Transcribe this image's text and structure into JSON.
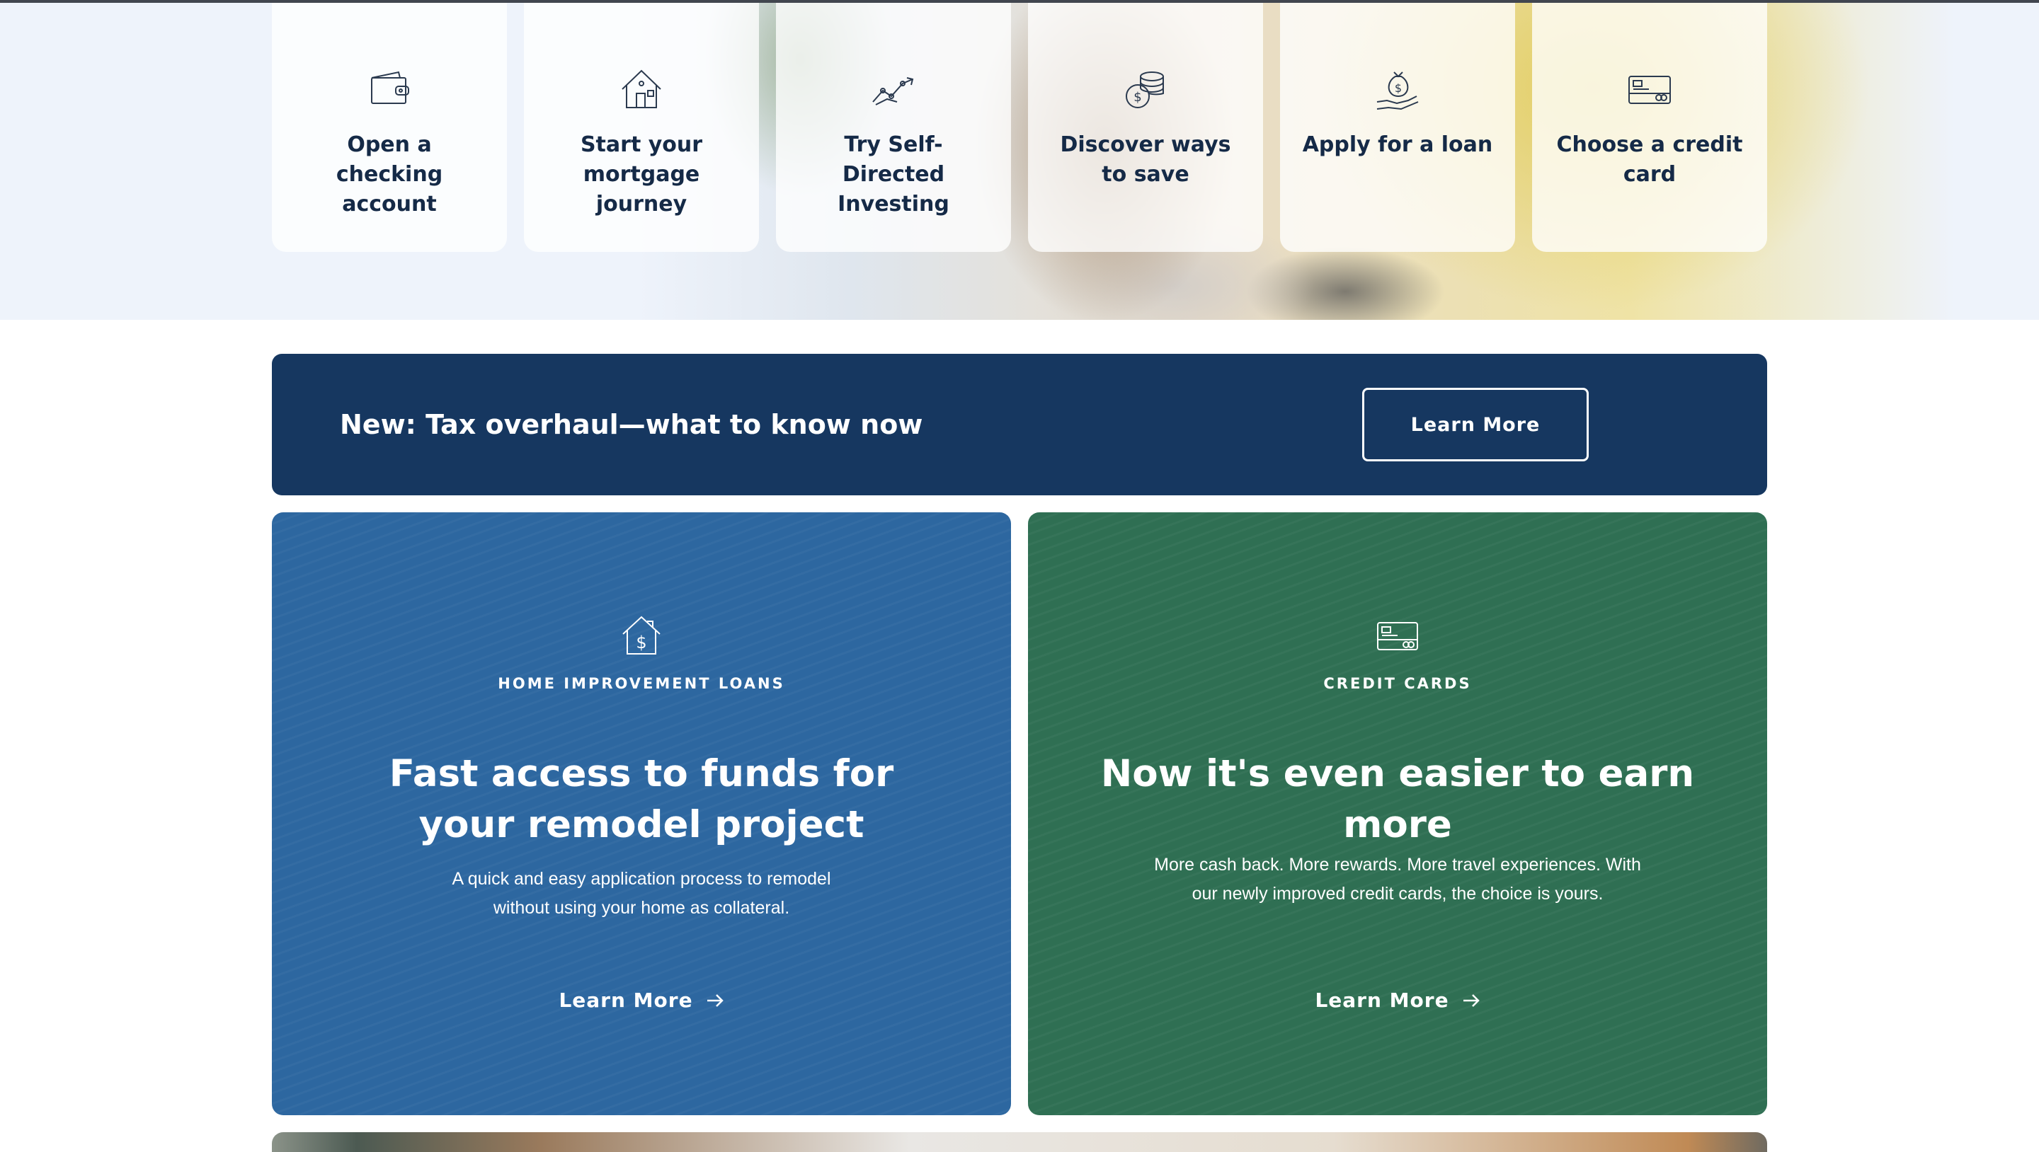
{
  "quick_links": [
    {
      "label": "Open a checking account",
      "icon": "wallet-icon"
    },
    {
      "label": "Start your mortgage journey",
      "icon": "house-icon"
    },
    {
      "label": "Try Self-Directed Investing",
      "icon": "trend-chart-icon"
    },
    {
      "label": "Discover ways to save",
      "icon": "coins-icon"
    },
    {
      "label": "Apply for a loan",
      "icon": "money-bag-hand-icon"
    },
    {
      "label": "Choose a credit card",
      "icon": "credit-card-icon"
    }
  ],
  "banner": {
    "title": "New: Tax overhaul—what to know now",
    "button_label": "Learn More"
  },
  "cards": [
    {
      "icon": "house-dollar-icon",
      "eyebrow": "HOME IMPROVEMENT LOANS",
      "heading": "Fast access to funds for your remodel project",
      "description": "A quick and easy application process to remodel without using your home as collateral.",
      "link_label": "Learn More",
      "color": "#2d67a0"
    },
    {
      "icon": "credit-card-icon",
      "eyebrow": "CREDIT CARDS",
      "heading": "Now it's even easier to earn more",
      "description": "More cash back. More rewards. More travel experiences. With our newly improved credit cards, the choice is yours.",
      "link_label": "Learn More",
      "color": "#2f6f53"
    }
  ],
  "colors": {
    "banner_bg": "#163760",
    "tile_text": "#152a47",
    "blue_card": "#2d67a0",
    "green_card": "#2f6f53"
  }
}
